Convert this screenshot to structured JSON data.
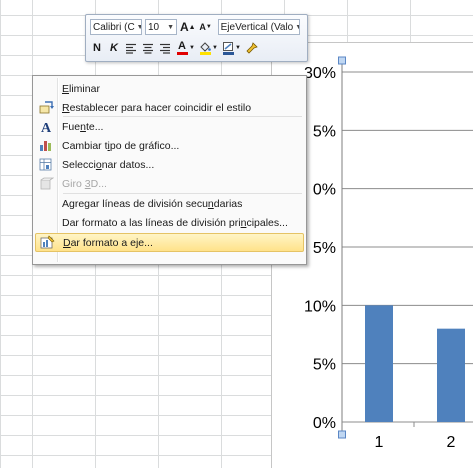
{
  "mini_toolbar": {
    "font_name": "Calibri (C",
    "font_size": "10",
    "element_selector": "EjeVertical (Valo",
    "grow_font_icon": "A",
    "shrink_font_icon": "A",
    "bold_label": "N",
    "italic_label": "K",
    "font_color_label": "A"
  },
  "context_menu": {
    "items": [
      {
        "label_pre": "",
        "label_ul": "E",
        "label_post": "liminar",
        "icon": "",
        "disabled": false,
        "highlight": false
      },
      {
        "label_pre": "",
        "label_ul": "R",
        "label_post": "establecer para hacer coincidir el estilo",
        "icon": "reset-style-icon",
        "disabled": false,
        "highlight": false
      },
      {
        "label_pre": "Fue",
        "label_ul": "n",
        "label_post": "te...",
        "icon": "font-icon",
        "disabled": false,
        "highlight": false
      },
      {
        "label_pre": "Cambiar t",
        "label_ul": "i",
        "label_post": "po de gráfico...",
        "icon": "chart-type-icon",
        "disabled": false,
        "highlight": false
      },
      {
        "label_pre": "Selecci",
        "label_ul": "o",
        "label_post": "nar datos...",
        "icon": "select-data-icon",
        "disabled": false,
        "highlight": false
      },
      {
        "label_pre": "Giro ",
        "label_ul": "3",
        "label_post": "D...",
        "icon": "3d-rotation-icon",
        "disabled": true,
        "highlight": false
      },
      {
        "label_pre": "Agregar líneas de división secu",
        "label_ul": "n",
        "label_post": "darias",
        "icon": "",
        "disabled": false,
        "highlight": false
      },
      {
        "label_pre": "Dar formato a las líneas de división pri",
        "label_ul": "n",
        "label_post": "cipales...",
        "icon": "",
        "disabled": false,
        "highlight": false
      },
      {
        "label_pre": "",
        "label_ul": "D",
        "label_post": "ar formato a eje...",
        "icon": "format-axis-icon",
        "disabled": false,
        "highlight": true
      }
    ]
  },
  "chart_data": {
    "type": "bar",
    "categories": [
      "1",
      "2"
    ],
    "values": [
      0.1,
      0.08
    ],
    "ylim": [
      0,
      0.3
    ],
    "ytick_labels": [
      "0%",
      "5%",
      "10%",
      "5%",
      "0%",
      "5%",
      "30%"
    ],
    "yticks": [
      0,
      0.05,
      0.1,
      0.15,
      0.2,
      0.25,
      0.3
    ],
    "bar_color": "#4f81bd",
    "grid": true
  }
}
